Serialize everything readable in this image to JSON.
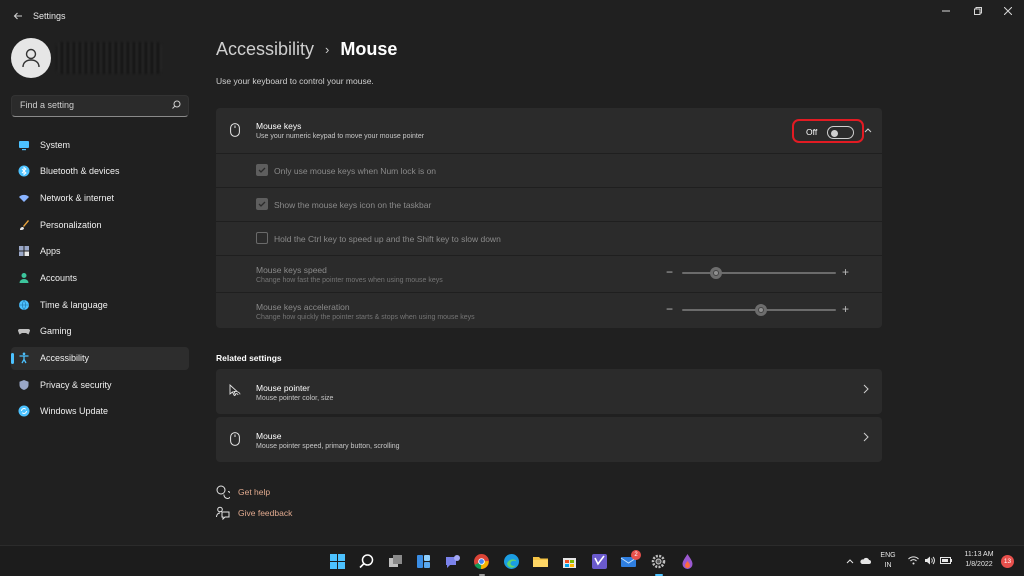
{
  "window": {
    "title": "Settings",
    "back_icon": "arrow-left-icon"
  },
  "sidebar": {
    "search_placeholder": "Find a setting",
    "items": [
      {
        "label": "System",
        "icon": "monitor-icon",
        "color": "#4cc2ff",
        "active": false
      },
      {
        "label": "Bluetooth & devices",
        "icon": "bluetooth-icon",
        "color": "#4cc2ff",
        "active": false
      },
      {
        "label": "Network & internet",
        "icon": "wifi-icon",
        "color": "#8ab4ff",
        "active": false
      },
      {
        "label": "Personalization",
        "icon": "brush-icon",
        "color": "#e8a33d",
        "active": false
      },
      {
        "label": "Apps",
        "icon": "apps-icon",
        "color": "#9aa7c7",
        "active": false
      },
      {
        "label": "Accounts",
        "icon": "person-icon",
        "color": "#3cc59c",
        "active": false
      },
      {
        "label": "Time & language",
        "icon": "globe-clock-icon",
        "color": "#4cc2ff",
        "active": false
      },
      {
        "label": "Gaming",
        "icon": "gamepad-icon",
        "color": "#c0c0c0",
        "active": false
      },
      {
        "label": "Accessibility",
        "icon": "accessibility-icon",
        "color": "#4cc2ff",
        "active": true
      },
      {
        "label": "Privacy & security",
        "icon": "shield-icon",
        "color": "#9aa7c7",
        "active": false
      },
      {
        "label": "Windows Update",
        "icon": "update-icon",
        "color": "#4cc2ff",
        "active": false
      }
    ]
  },
  "breadcrumb": {
    "parent": "Accessibility",
    "separator": "›",
    "current": "Mouse"
  },
  "page_description": "Use your keyboard to control your mouse.",
  "mouse_keys": {
    "title": "Mouse keys",
    "subtitle": "Use your numeric keypad to move your mouse pointer",
    "toggle_label": "Off",
    "toggle_on": false,
    "options": [
      {
        "label": "Only use mouse keys when Num lock is on",
        "checked": true
      },
      {
        "label": "Show the mouse keys icon on the taskbar",
        "checked": true
      },
      {
        "label": "Hold the Ctrl key to speed up and the Shift key to slow down",
        "checked": false
      }
    ],
    "speed": {
      "title": "Mouse keys speed",
      "subtitle": "Change how fast the pointer moves when using mouse keys",
      "value_fraction": 0.22
    },
    "acceleration": {
      "title": "Mouse keys acceleration",
      "subtitle": "Change how quickly the pointer starts & stops when using mouse keys",
      "value_fraction": 0.51
    }
  },
  "related": {
    "heading": "Related settings",
    "items": [
      {
        "title": "Mouse pointer",
        "subtitle": "Mouse pointer color, size",
        "icon": "mouse-pointer-icon"
      },
      {
        "title": "Mouse",
        "subtitle": "Mouse pointer speed, primary button, scrolling",
        "icon": "mouse-icon"
      }
    ]
  },
  "help": {
    "get_help": "Get help",
    "give_feedback": "Give feedback"
  },
  "taskbar": {
    "notification_badge": "2",
    "language_line1": "ENG",
    "language_line2": "IN",
    "time": "11:13 AM",
    "date": "1/8/2022",
    "notification_count": "13"
  }
}
